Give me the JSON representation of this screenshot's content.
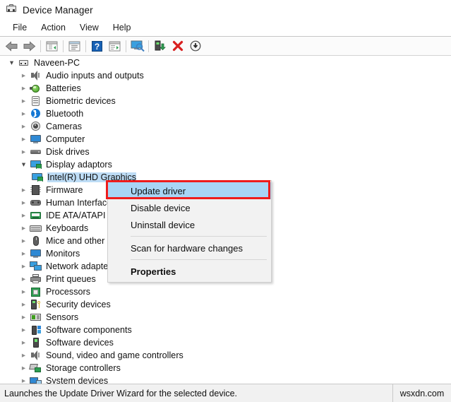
{
  "window": {
    "title": "Device Manager",
    "icon": "device-manager-icon"
  },
  "menubar": {
    "items": [
      {
        "label": "File"
      },
      {
        "label": "Action"
      },
      {
        "label": "View"
      },
      {
        "label": "Help"
      }
    ]
  },
  "toolbar": {
    "buttons": [
      {
        "name": "back-arrow-icon"
      },
      {
        "name": "forward-arrow-icon"
      },
      {
        "name": "show-hide-console-tree-icon"
      },
      {
        "name": "properties-icon"
      },
      {
        "name": "help-icon"
      },
      {
        "name": "update-driver-icon"
      },
      {
        "name": "scan-for-hardware-changes-icon"
      },
      {
        "name": "add-legacy-hardware-icon"
      },
      {
        "name": "uninstall-device-icon"
      },
      {
        "name": "disable-device-icon"
      }
    ]
  },
  "tree": {
    "nodes": [
      {
        "label": "Naveen-PC",
        "icon": "computer-icon",
        "level": 0,
        "expanded": true,
        "selected": false,
        "truncated": false
      },
      {
        "label": "Audio inputs and outputs",
        "icon": "speaker-icon",
        "level": 1,
        "expanded": false,
        "selected": false,
        "truncated": false
      },
      {
        "label": "Batteries",
        "icon": "battery-icon",
        "level": 1,
        "expanded": false,
        "selected": false,
        "truncated": false
      },
      {
        "label": "Biometric devices",
        "icon": "fingerprint-icon",
        "level": 1,
        "expanded": false,
        "selected": false,
        "truncated": false
      },
      {
        "label": "Bluetooth",
        "icon": "bluetooth-icon",
        "level": 1,
        "expanded": false,
        "selected": false,
        "truncated": false
      },
      {
        "label": "Cameras",
        "icon": "camera-icon",
        "level": 1,
        "expanded": false,
        "selected": false,
        "truncated": false
      },
      {
        "label": "Computer",
        "icon": "monitor-icon",
        "level": 1,
        "expanded": false,
        "selected": false,
        "truncated": false
      },
      {
        "label": "Disk drives",
        "icon": "disk-drive-icon",
        "level": 1,
        "expanded": false,
        "selected": false,
        "truncated": false
      },
      {
        "label": "Display adaptors",
        "icon": "display-adapter-icon",
        "level": 1,
        "expanded": true,
        "selected": false,
        "truncated": false
      },
      {
        "label": "Intel(R) UHD Graphics",
        "icon": "display-adapter-icon",
        "level": 2,
        "expanded": null,
        "selected": true,
        "truncated": false
      },
      {
        "label": "Firmware",
        "icon": "firmware-icon",
        "level": 1,
        "expanded": false,
        "selected": false,
        "truncated": false
      },
      {
        "label": "Human Interface",
        "icon": "human-interface-icon",
        "level": 1,
        "expanded": false,
        "selected": false,
        "truncated": true
      },
      {
        "label": "IDE ATA/ATAPI co",
        "icon": "ide-controller-icon",
        "level": 1,
        "expanded": false,
        "selected": false,
        "truncated": true
      },
      {
        "label": "Keyboards",
        "icon": "keyboard-icon",
        "level": 1,
        "expanded": false,
        "selected": false,
        "truncated": false
      },
      {
        "label": "Mice and other p",
        "icon": "mouse-icon",
        "level": 1,
        "expanded": false,
        "selected": false,
        "truncated": true
      },
      {
        "label": "Monitors",
        "icon": "monitor-icon",
        "level": 1,
        "expanded": false,
        "selected": false,
        "truncated": false
      },
      {
        "label": "Network adapters",
        "icon": "network-adapter-icon",
        "level": 1,
        "expanded": false,
        "selected": false,
        "truncated": true
      },
      {
        "label": "Print queues",
        "icon": "printer-icon",
        "level": 1,
        "expanded": false,
        "selected": false,
        "truncated": false
      },
      {
        "label": "Processors",
        "icon": "processor-icon",
        "level": 1,
        "expanded": false,
        "selected": false,
        "truncated": false
      },
      {
        "label": "Security devices",
        "icon": "security-device-icon",
        "level": 1,
        "expanded": false,
        "selected": false,
        "truncated": false
      },
      {
        "label": "Sensors",
        "icon": "sensor-icon",
        "level": 1,
        "expanded": false,
        "selected": false,
        "truncated": false
      },
      {
        "label": "Software components",
        "icon": "software-component-icon",
        "level": 1,
        "expanded": false,
        "selected": false,
        "truncated": false
      },
      {
        "label": "Software devices",
        "icon": "software-device-icon",
        "level": 1,
        "expanded": false,
        "selected": false,
        "truncated": false
      },
      {
        "label": "Sound, video and game controllers",
        "icon": "sound-icon",
        "level": 1,
        "expanded": false,
        "selected": false,
        "truncated": false
      },
      {
        "label": "Storage controllers",
        "icon": "storage-controller-icon",
        "level": 1,
        "expanded": false,
        "selected": false,
        "truncated": false
      },
      {
        "label": "System devices",
        "icon": "system-device-icon",
        "level": 1,
        "expanded": false,
        "selected": false,
        "truncated": false
      }
    ]
  },
  "context_menu": {
    "items": [
      {
        "label": "Update driver",
        "type": "item",
        "highlighted": true,
        "bold": false
      },
      {
        "label": "Disable device",
        "type": "item",
        "highlighted": false,
        "bold": false
      },
      {
        "label": "Uninstall device",
        "type": "item",
        "highlighted": false,
        "bold": false
      },
      {
        "label": "",
        "type": "separator",
        "highlighted": false,
        "bold": false
      },
      {
        "label": "Scan for hardware changes",
        "type": "item",
        "highlighted": false,
        "bold": false
      },
      {
        "label": "",
        "type": "separator",
        "highlighted": false,
        "bold": false
      },
      {
        "label": "Properties",
        "type": "item",
        "highlighted": false,
        "bold": true
      }
    ]
  },
  "highlight": {
    "color": "#ee1c1c",
    "target": "Update driver"
  },
  "statusbar": {
    "message": "Launches the Update Driver Wizard for the selected device.",
    "right_panel": "wsxdn.com"
  },
  "colors": {
    "selection": "#bddcf5",
    "menu_highlight": "#a8d5f5",
    "annotation_red": "#ee1c1c",
    "window_bg": "#ffffff",
    "status_bg": "#f1f1f1"
  }
}
